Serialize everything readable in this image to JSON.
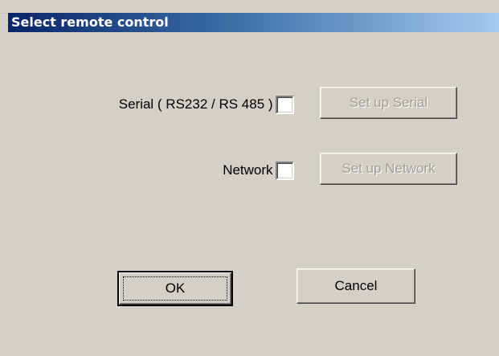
{
  "window": {
    "title": "Select remote control"
  },
  "serial": {
    "label": "Serial ( RS232 / RS 485 ) :",
    "checked": false,
    "setup_button": "Set up Serial",
    "setup_enabled": false
  },
  "network": {
    "label": "Network :",
    "checked": false,
    "setup_button": "Set up Network",
    "setup_enabled": false
  },
  "buttons": {
    "ok": "OK",
    "cancel": "Cancel"
  },
  "colors": {
    "dialog_background": "#d4d0c8",
    "title_gradient_start": "#0a246a",
    "title_gradient_end": "#a6caf0",
    "title_text": "#ffffff",
    "disabled_text": "#a09c94"
  }
}
